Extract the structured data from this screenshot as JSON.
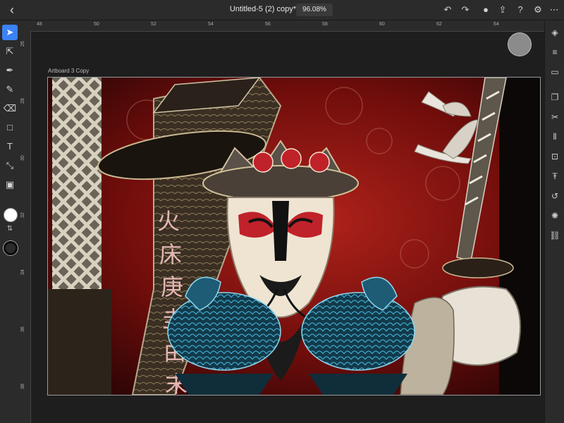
{
  "header": {
    "back_icon": "chevron-left-icon",
    "document_title": "Untitled-5 (2) copy*",
    "zoom_level": "96.08%"
  },
  "toolbar_right_icons": [
    "undo-icon",
    "redo-icon",
    "user-icon",
    "share-icon",
    "help-icon",
    "gear-icon"
  ],
  "left_tools": [
    "select",
    "direct-select",
    "pen",
    "pencil",
    "eraser",
    "shape",
    "type",
    "transform",
    "image"
  ],
  "right_panel_icons": [
    "layers",
    "properties",
    "comments",
    "swatches",
    "cut",
    "align",
    "transform",
    "type",
    "path",
    "effects",
    "link"
  ],
  "rulers": {
    "horizontal": [
      "48",
      "50",
      "52",
      "54",
      "56",
      "58",
      "60",
      "62",
      "64"
    ],
    "vertical": [
      "26",
      "28",
      "30",
      "32",
      "34",
      "36",
      "38",
      "40",
      "42",
      "44"
    ]
  },
  "artboard": {
    "name": "Artboard 3 Copy"
  },
  "calligraphy": [
    "火",
    "床",
    "庚",
    "圭",
    "由",
    "末"
  ],
  "colors": {
    "accent": "#3b82f6",
    "panel": "#2b2b2b",
    "canvas": "#1e1e1e",
    "art_red": "#7a0e0c"
  }
}
